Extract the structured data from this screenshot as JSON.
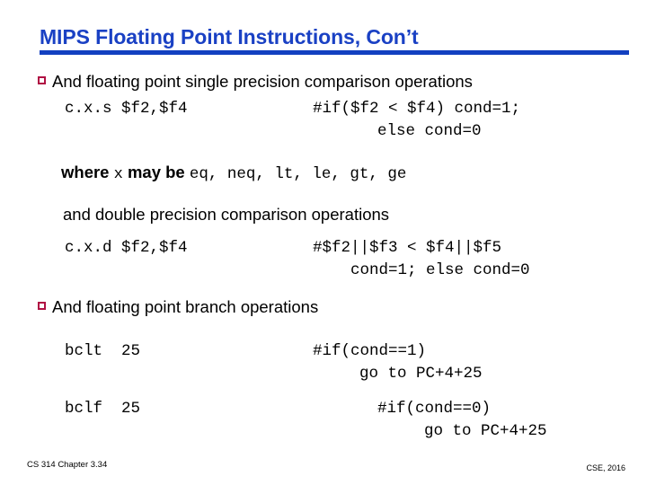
{
  "slide": {
    "title": "MIPS Floating Point Instructions, Con’t",
    "title_color": "#1a41c4",
    "rule_color": "#1240c0",
    "bullet_color": "#b01043",
    "bullet_icon": "hollow-square-bullet"
  },
  "bullets": [
    {
      "text": "And floating point single precision comparison operations"
    },
    {
      "text": "And floating point branch operations"
    }
  ],
  "single_precision": {
    "instruction": "c.x.s $f2,$f4",
    "comment_line1": "#if($f2 < $f4) cond=1;",
    "comment_line2": "else cond=0"
  },
  "where_line": {
    "prefix": "where ",
    "variable": "x",
    "middle": " may be ",
    "options": "eq, neq, lt, le, gt, ge"
  },
  "double_precision": {
    "heading": "and double precision comparison operations",
    "instruction": "c.x.d $f2,$f4",
    "comment_line1": "#$f2||$f3 < $f4||$f5",
    "comment_line2": "cond=1; else cond=0"
  },
  "branches": [
    {
      "instruction": "bclt  25",
      "comment_line1": "#if(cond==1)",
      "comment_line2": "go to PC+4+25"
    },
    {
      "instruction": "bclf  25",
      "comment_line1": "#if(cond==0)",
      "comment_line2": "go to PC+4+25"
    }
  ],
  "footer": {
    "left": "CS 314 Chapter 3.34",
    "right": "CSE, 2016"
  }
}
